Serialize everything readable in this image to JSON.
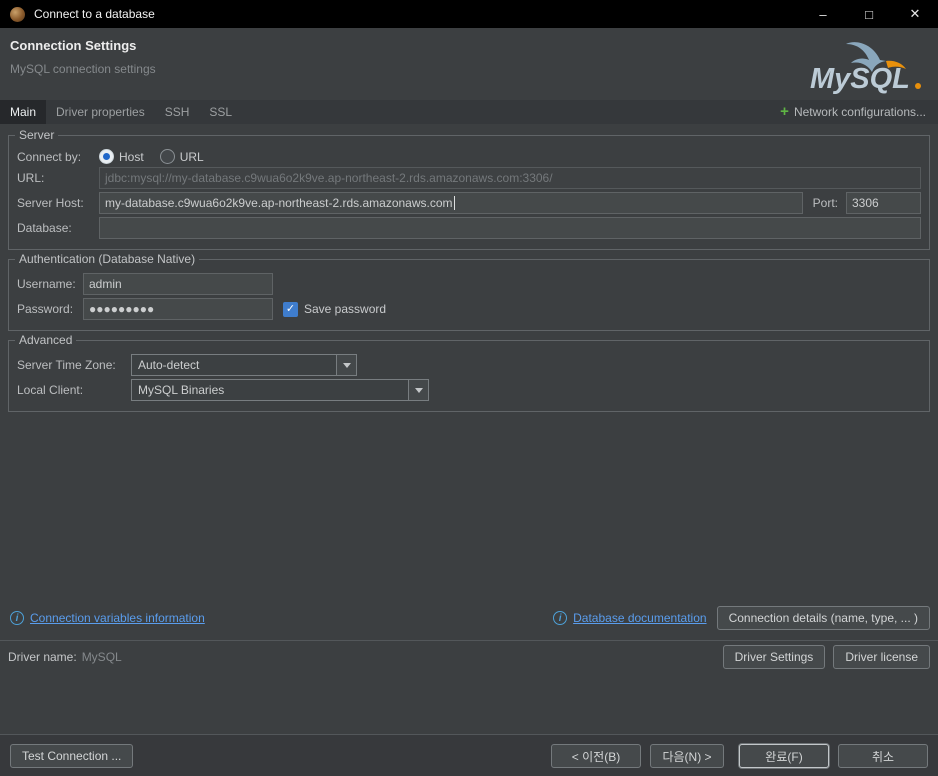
{
  "window": {
    "title": "Connect to a database"
  },
  "header": {
    "title": "Connection Settings",
    "subtitle": "MySQL connection settings",
    "logo_text": "MySQL"
  },
  "tabs": [
    {
      "label": "Main",
      "active": true
    },
    {
      "label": "Driver properties",
      "active": false
    },
    {
      "label": "SSH",
      "active": false
    },
    {
      "label": "SSL",
      "active": false
    }
  ],
  "toolbar": {
    "network_configurations": "Network configurations..."
  },
  "server": {
    "legend": "Server",
    "connect_by_label": "Connect by:",
    "host_radio": "Host",
    "url_radio": "URL",
    "url_label": "URL:",
    "url_value": "jdbc:mysql://my-database.c9wua6o2k9ve.ap-northeast-2.rds.amazonaws.com:3306/",
    "server_host_label": "Server Host:",
    "server_host_value": "my-database.c9wua6o2k9ve.ap-northeast-2.rds.amazonaws.com",
    "port_label": "Port:",
    "port_value": "3306",
    "database_label": "Database:",
    "database_value": ""
  },
  "auth": {
    "legend": "Authentication (Database Native)",
    "username_label": "Username:",
    "username_value": "admin",
    "password_label": "Password:",
    "password_value": "●●●●●●●●●",
    "save_password_label": "Save password",
    "save_password_checked": true
  },
  "advanced": {
    "legend": "Advanced",
    "timezone_label": "Server Time Zone:",
    "timezone_value": "Auto-detect",
    "local_client_label": "Local Client:",
    "local_client_value": "MySQL Binaries"
  },
  "footer_links": {
    "connection_variables": "Connection variables information",
    "database_documentation": "Database documentation",
    "connection_details": "Connection details (name, type, ... )"
  },
  "driver": {
    "label": "Driver name:",
    "value": "MySQL",
    "settings_button": "Driver Settings",
    "license_button": "Driver license"
  },
  "bottom": {
    "test_connection": "Test Connection ...",
    "back": "< 이전(B)",
    "next": "다음(N) >",
    "finish": "완료(F)",
    "cancel": "취소"
  },
  "icons": {
    "check": "✓",
    "info": "i",
    "plus": "+",
    "minimize": "–",
    "maximize": "□",
    "close": "✕"
  },
  "colors": {
    "accent_blue": "#3f7dcd",
    "link_blue": "#5a9ded",
    "plus_green": "#5fb544",
    "mysql_orange": "#e8900c",
    "panel_bg": "#3c3f41"
  }
}
